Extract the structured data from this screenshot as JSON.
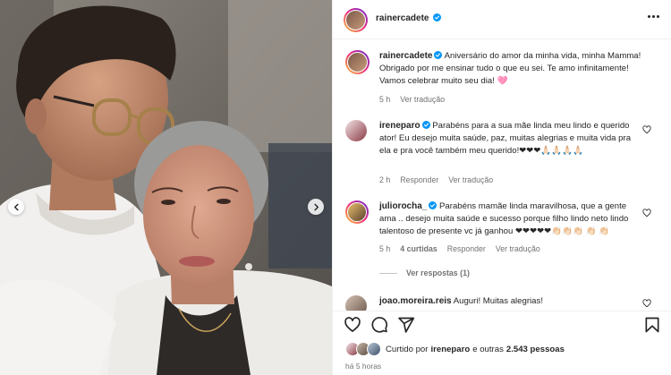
{
  "post": {
    "author": "rainercadete",
    "more_label": "Mais opções"
  },
  "carousel": {
    "prev_label": "Anterior",
    "next_label": "Próximo"
  },
  "caption": {
    "username": "rainercadete",
    "text": "Aniversário do amor da minha vida, minha Mamma! Obrigado por me ensinar tudo o que eu sei. Te amo infinitamente! Vamos celebrar muito seu dia! 🩷",
    "time": "5 h",
    "translate": "Ver tradução"
  },
  "comments": [
    {
      "username": "ireneparo",
      "text": "Parabéns para a sua mãe linda meu lindo e querido ator! Eu desejo muita saúde, paz, muitas alegrias e muita vida pra ela e pra você também meu querido!❤❤❤🙏🏻🙏🏻🙏🏻🙏🏻",
      "time": "2 h",
      "reply": "Responder",
      "translate": "Ver tradução"
    },
    {
      "username": "juliorocha_",
      "text": "Parabéns mamãe linda maravilhosa, que a gente ama .. desejo muita saúde e sucesso porque filho lindo neto lindo talentoso de presente vc já ganhou ❤❤❤❤❤👏🏻👏🏻👏🏻 👏🏻 👏🏻",
      "time": "5 h",
      "likes": "4 curtidas",
      "reply": "Responder",
      "translate": "Ver tradução",
      "view_replies": "Ver respostas (1)"
    },
    {
      "username": "joao.moreira.reis",
      "text": "Auguri! Muitas alegrias!"
    }
  ],
  "likes": {
    "prefix": "Curtido por",
    "user": "ireneparo",
    "middle": "e outras",
    "count": "2.543 pessoas"
  },
  "timestamp": "há 5 horas",
  "icons": [
    "verified-badge-icon",
    "more-icon",
    "heart-icon",
    "comment-icon",
    "share-icon",
    "bookmark-icon",
    "chevron-left-icon",
    "chevron-right-icon"
  ],
  "colors": {
    "accent": "#0095f6",
    "text": "#262626",
    "muted": "#737373",
    "border": "#efefef"
  }
}
